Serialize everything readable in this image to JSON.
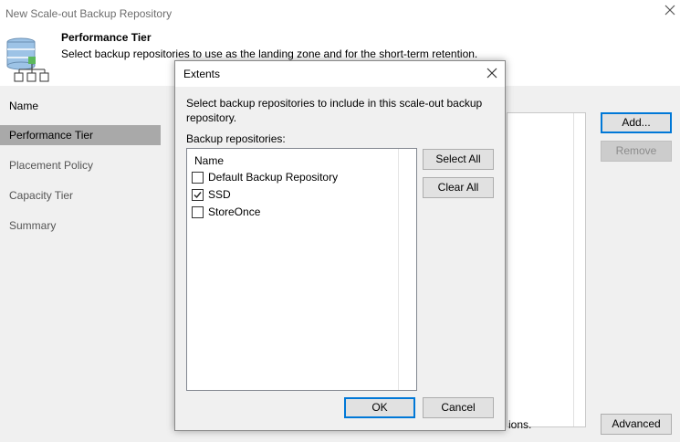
{
  "window": {
    "title": "New Scale-out Backup Repository"
  },
  "header": {
    "title": "Performance Tier",
    "description": "Select backup repositories to use as the landing zone and for the short-term retention."
  },
  "nav": {
    "items": [
      {
        "label": "Name"
      },
      {
        "label": "Performance Tier"
      },
      {
        "label": "Placement Policy"
      },
      {
        "label": "Capacity Tier"
      },
      {
        "label": "Summary"
      }
    ]
  },
  "background": {
    "add_label": "Add...",
    "remove_label": "Remove",
    "advanced_label": "Advanced",
    "options_fragment": "ions."
  },
  "dialog": {
    "title": "Extents",
    "instruction": "Select backup repositories to include in this scale-out backup repository.",
    "repositories_label": "Backup repositories:",
    "column_name": "Name",
    "repositories": [
      {
        "name": "Default Backup Repository",
        "checked": false
      },
      {
        "name": "SSD",
        "checked": true
      },
      {
        "name": "StoreOnce",
        "checked": false
      }
    ],
    "select_all_label": "Select All",
    "clear_all_label": "Clear All",
    "ok_label": "OK",
    "cancel_label": "Cancel"
  },
  "colors": {
    "accent": "#0078d7",
    "selected_nav": "#a9a9a9",
    "icon_green": "#5cb85c",
    "icon_blue": "#9dc3e6"
  }
}
